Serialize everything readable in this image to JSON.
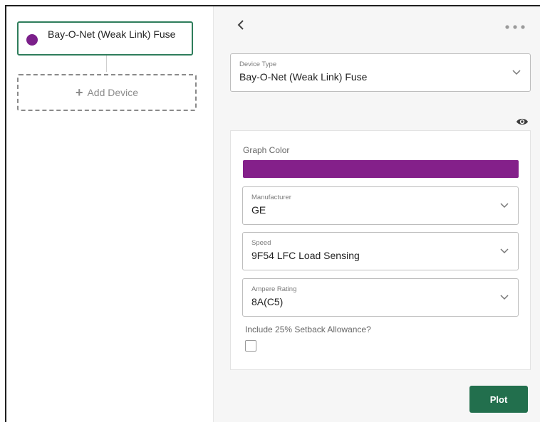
{
  "devices": [
    {
      "label": "Bay-O-Net (Weak Link) Fuse",
      "color": "#7b1f8a"
    }
  ],
  "add_device": {
    "label": "Add Device"
  },
  "header": {
    "back_icon": "chevron-left-icon",
    "more_icon": "more-horizontal-icon"
  },
  "device_type": {
    "label": "Device Type",
    "value": "Bay-O-Net (Weak Link) Fuse"
  },
  "visibility_icon": "eye-icon",
  "graph_color": {
    "label": "Graph Color",
    "color": "#84208a"
  },
  "manufacturer": {
    "label": "Manufacturer",
    "value": "GE"
  },
  "speed": {
    "label": "Speed",
    "value": "9F54 LFC Load Sensing"
  },
  "ampere_rating": {
    "label": "Ampere Rating",
    "value": "8A(C5)"
  },
  "setback": {
    "label": "Include 25% Setback Allowance?",
    "checked": false
  },
  "plot": {
    "label": "Plot",
    "color": "#226f4d"
  }
}
